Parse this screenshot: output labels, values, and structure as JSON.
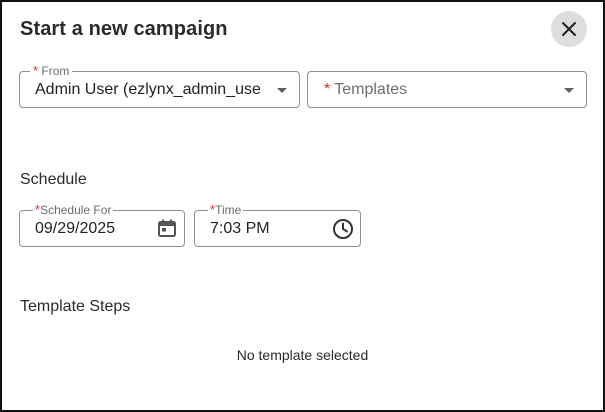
{
  "dialog": {
    "title": "Start a new campaign",
    "close_icon": "close-icon"
  },
  "from": {
    "label": "From",
    "required_mark": "*",
    "value": "Admin User (ezlynx_admin_use"
  },
  "templates": {
    "required_mark": "*",
    "placeholder": "Templates"
  },
  "schedule": {
    "heading": "Schedule",
    "date": {
      "label": "Schedule For",
      "required_mark": "*",
      "value": "09/29/2025",
      "icon": "calendar-icon"
    },
    "time": {
      "label": "Time",
      "required_mark": "*",
      "value": "7:03 PM",
      "icon": "clock-icon"
    }
  },
  "template_steps": {
    "heading": "Template Steps",
    "empty_message": "No template selected"
  },
  "colors": {
    "required": "#d32f2f",
    "border": "#8f8f8f",
    "close_bg": "#dedede"
  }
}
